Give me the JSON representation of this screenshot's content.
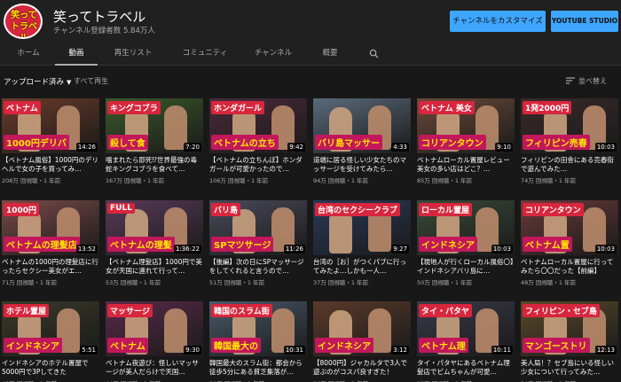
{
  "channel": {
    "avatar_text": "笑って トラベル",
    "title": "笑ってトラベル",
    "subscribers": "チャンネル登録者数 5.84万人",
    "customize_label": "チャンネルをカスタマイズ",
    "studio_label": "YOUTUBE STUDIO"
  },
  "tabs": [
    {
      "label": "ホーム"
    },
    {
      "label": "動画"
    },
    {
      "label": "再生リスト"
    },
    {
      "label": "コミュニティ"
    },
    {
      "label": "チャンネル"
    },
    {
      "label": "概要"
    }
  ],
  "filter": {
    "uploads_label": "アップロード済み",
    "play_all_label": "すべて再生",
    "sort_label": "並べ替え"
  },
  "videos": [
    {
      "top": "ベトナム",
      "bottom": "1000円デリバ",
      "duration": "14:26",
      "title": "【ベトナム風俗】1000円のデリヘルで女の子を買ってみ…",
      "meta": "208万 回視聴・1 年前",
      "bg": "#6b3b2a"
    },
    {
      "top": "キングコブラ",
      "bottom": "殺して食",
      "duration": "7:20",
      "title": "噛まれたら即死⁉世界最強の毒蛇キングコブラを食べて…",
      "meta": "167万 回視聴・1 年前",
      "bg": "#3a5a2a"
    },
    {
      "top": "ホンダガール",
      "bottom": "ベトナムの立ち",
      "duration": "9:42",
      "title": "【ベトナムの立ちんぼ】ホンダガールが可愛かったので…",
      "meta": "106万 回視聴・1 年前",
      "bg": "#4a2a3a"
    },
    {
      "top": "",
      "bottom": "バリ島マッサー",
      "duration": "4:33",
      "title": "道端に居る怪しい少女たちのマッサージを受けてみたら…",
      "meta": "94万 回視聴・1 年前",
      "bg": "#5a6a7a"
    },
    {
      "top": "ベトナム 美女",
      "bottom": "コリアンタウン",
      "duration": "9:10",
      "title": "ベトナムローカル置屋レビュー 美女の多い店はどこ？…",
      "meta": "85万 回視聴・1 年前",
      "bg": "#6a4a3a"
    },
    {
      "top": "1発2000円",
      "bottom": "フィリピン売春",
      "duration": "10:03",
      "title": "フィリピンの田舎にある売春街で遊んでみた…",
      "meta": "74万 回視聴・1 年前",
      "bg": "#3a2a2a"
    },
    {
      "top": "1000円",
      "bottom": "ベトナムの理髪店",
      "duration": "13:52",
      "title": "ベトナムの1000円の理髪店に行ったらセクシー美女がエ…",
      "meta": "71万 回視聴・1 年前",
      "bg": "#7a4a4a"
    },
    {
      "top": "FULL",
      "bottom": "ベトナムの理髪",
      "duration": "1:36:22",
      "title": "【ベトナム理髪店】1000円で美女が天国に連れて行って…",
      "meta": "53万 回視聴・1 年前",
      "bg": "#5a3a5a"
    },
    {
      "top": "バリ島",
      "bottom": "SPマツサージ",
      "duration": "11:26",
      "title": "【後編】次の日にSPマッサージをしてくれると言うので…",
      "meta": "51万 回視聴・1 年前",
      "bg": "#4a4a5a"
    },
    {
      "top": "台湾のセクシークラブ",
      "bottom": "",
      "duration": "9:27",
      "title": "台湾の［お］がつくパブに行ってみたよ…しかも一人…",
      "meta": "37万 回視聴・1 年前",
      "bg": "#2a3a5a"
    },
    {
      "top": "ローカル置屋",
      "bottom": "インドネシア",
      "duration": "10:03",
      "title": "【現地人が行くローカル風俗〇】インドネシアバリ島に…",
      "meta": "50万 回視聴・1 年前",
      "bg": "#3a4a3a"
    },
    {
      "top": "コリアンタウン",
      "bottom": "ベトナム置",
      "duration": "10:03",
      "title": "ベトナムローカル置屋に行ってみたら〇〇だった【前編】",
      "meta": "48万 回視聴・1 年前",
      "bg": "#6a3a3a"
    },
    {
      "top": "ホテル置屋",
      "bottom": "インドネシア",
      "duration": "5:51",
      "title": "インドネシアのホテル置屋で5000円で3Pしてきた",
      "meta": "45万 回視聴・1 年前",
      "bg": "#3a3a2a"
    },
    {
      "top": "マッサージ",
      "bottom": "ベトナム",
      "duration": "9:30",
      "title": "ベトナム夜遊び：怪しいマッサージが美人だらけで天国…",
      "meta": "44万 回視聴・1 年前",
      "bg": "#5a2a4a"
    },
    {
      "top": "韓国のスラム街",
      "bottom": "韓国最大の",
      "duration": "10:31",
      "title": "韓国最大のスラム街：都会から徒歩5分にある貧乏集落が…",
      "meta": "38万 回視聴・1 年前",
      "bg": "#4a5a6a"
    },
    {
      "top": "",
      "bottom": "インドネシア",
      "duration": "3:12",
      "title": "【8000円】ジャカルタで3人で遊ぶのがコスパ良すぎた！",
      "meta": "36万 回視聴・1 年前",
      "bg": "#5a3a2a"
    },
    {
      "top": "タイ・パタヤ",
      "bottom": "ベトナム理",
      "duration": "10:11",
      "title": "タイ・パタヤにあるベトナム理髪店でピムちゃんが可愛…",
      "meta": "35万 回視聴・1 年前",
      "bg": "#3a3a4a"
    },
    {
      "top": "フィリピン・セブ島",
      "bottom": "マンゴーストリ",
      "duration": "12:13",
      "title": "美人局！？セブ島にいる怪しい少女について行ってみた…",
      "meta": "34万 回視聴・1 年前",
      "bg": "#5a4a2a"
    }
  ]
}
